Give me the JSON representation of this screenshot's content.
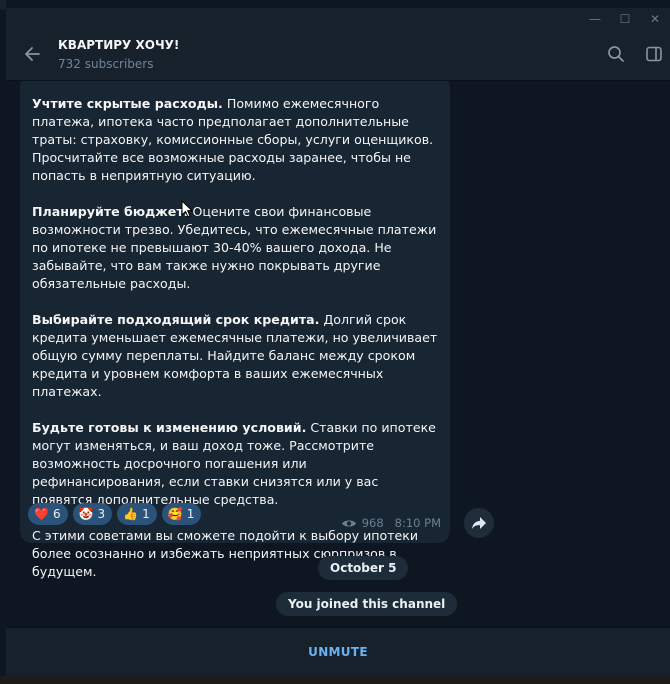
{
  "header": {
    "title": "КВАРТИРУ ХОЧУ!",
    "subtitle": "732 subscribers",
    "back_icon": "arrow-left-icon",
    "search_icon": "search-icon",
    "sidebar_icon": "sidebar-toggle-icon"
  },
  "window": {
    "minimize_label": "—",
    "maximize_label": "☐",
    "close_label": "✕"
  },
  "message": {
    "paragraphs": [
      {
        "bold": "Учтите скрытые расходы.",
        "text": " Помимо ежемесячного платежа, ипотека часто предполагает дополнительные траты: страховку, комиссионные сборы, услуги оценщиков. Просчитайте все возможные расходы заранее, чтобы не попасть в неприятную ситуацию."
      },
      {
        "bold": "Планируйте бюджет.",
        "text": " Оцените свои финансовые возможности трезво. Убедитесь, что ежемесячные платежи по ипотеке не превышают 30-40% вашего дохода. Не забывайте, что вам также нужно покрывать другие обязательные расходы."
      },
      {
        "bold": "Выбирайте подходящий срок кредита.",
        "text": " Долгий срок кредита уменьшает ежемесячные платежи, но увеличивает общую сумму переплаты. Найдите баланс между сроком кредита и уровнем комфорта в ваших ежемесячных платежах."
      },
      {
        "bold": "Будьте готовы к изменению условий.",
        "text": " Ставки по ипотеке могут изменяться, и ваш доход тоже. Рассмотрите возможность досрочного погашения или рефинансирования, если ставки снизятся или у вас появятся дополнительные средства."
      },
      {
        "bold": "",
        "text": "С этими советами вы сможете подойти к выбору ипотеки более осознанно и избежать неприятных сюрпризов в будущем."
      }
    ],
    "reactions": [
      {
        "emoji": "❤️",
        "count": "6",
        "icon": "heart-icon"
      },
      {
        "emoji": "🤡",
        "count": "3",
        "icon": "clown-icon"
      },
      {
        "emoji": "👍",
        "count": "1",
        "icon": "thumbs-up-icon"
      },
      {
        "emoji": "🥰",
        "count": "1",
        "icon": "smiling-hearts-icon"
      }
    ],
    "views": "968",
    "time": "8:10 PM"
  },
  "service": {
    "date": "October 5",
    "joined": "You joined this channel"
  },
  "footer": {
    "unmute_label": "UNMUTE"
  },
  "colors": {
    "background": "#0e1621",
    "panel": "#17212b",
    "bubble": "#182533",
    "reaction": "#2b5278",
    "accent": "#6ab3f3",
    "muted": "#708499"
  }
}
